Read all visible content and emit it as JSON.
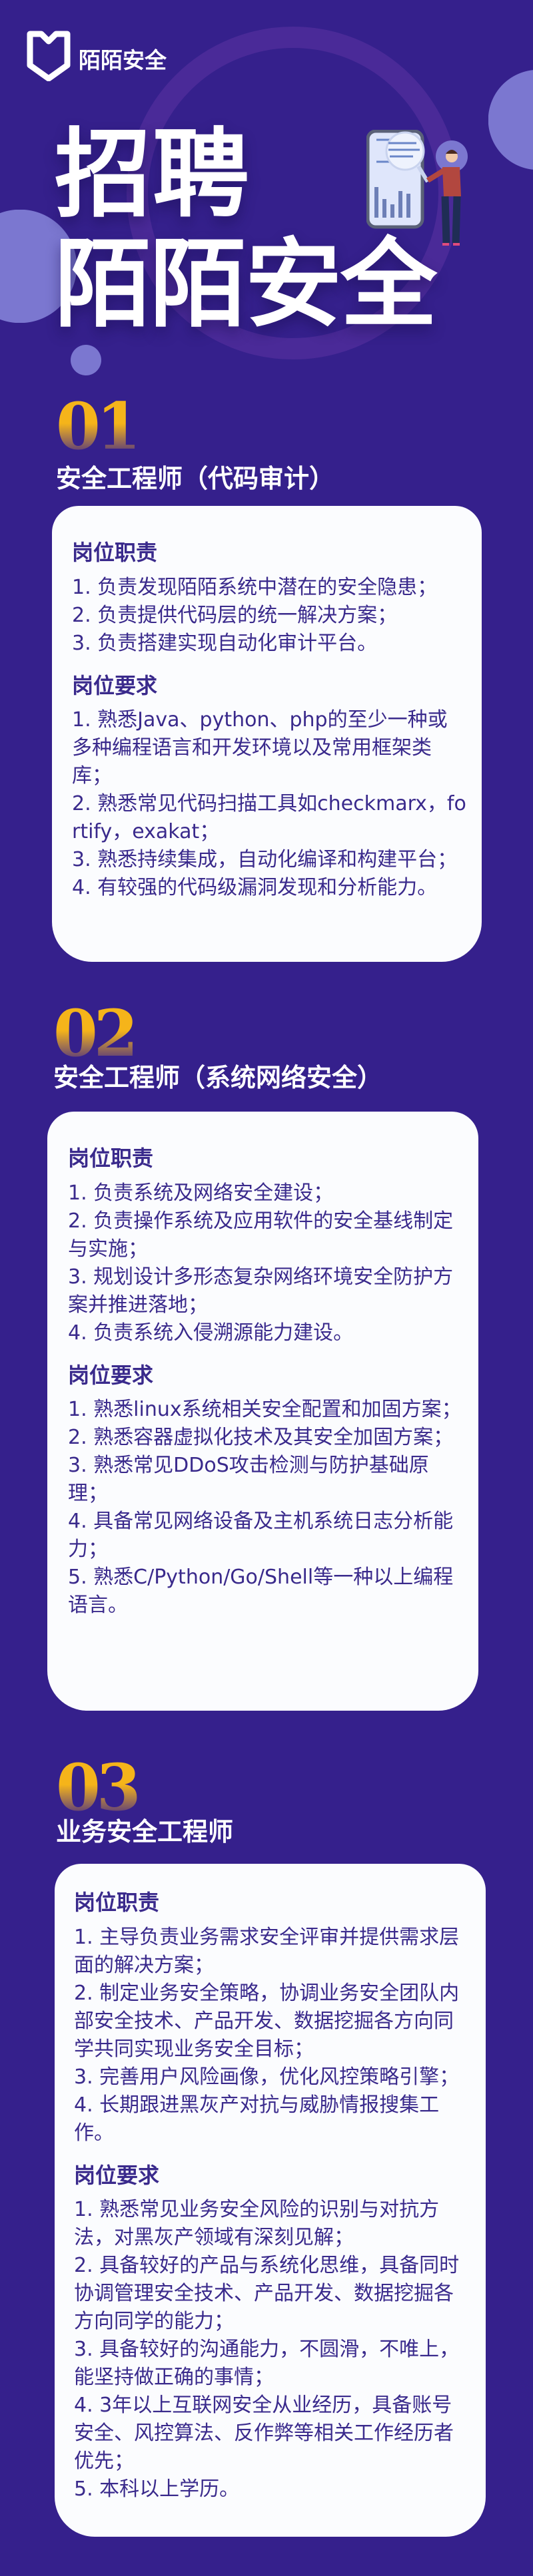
{
  "brand": {
    "name": "陌陌安全",
    "logo_icon": "shield-icon"
  },
  "hero": {
    "line1": "招聘",
    "line2": "陌陌安全",
    "illustration": "person-inspecting-report-icon"
  },
  "colors": {
    "background": "#35208c",
    "accent_gold": "#f5b41a",
    "card_text": "#3a2a8c",
    "circle": "#7b77d0"
  },
  "jobs": [
    {
      "number": "01",
      "title": "安全工程师（代码审计）",
      "duties_label": "岗位职责",
      "duties": [
        "1. 负责发现陌陌系统中潜在的安全隐患；",
        "2. 负责提供代码层的统一解决方案；",
        "3. 负责搭建实现自动化审计平台。"
      ],
      "req_label": "岗位要求",
      "reqs": [
        "1. 熟悉Java、python、php的至少一种或多种编程语言和开发环境以及常用框架类库；",
        "2. 熟悉常见代码扫描工具如checkmarx，fortify，exakat；",
        "3. 熟悉持续集成，自动化编译和构建平台；",
        "4. 有较强的代码级漏洞发现和分析能力。"
      ]
    },
    {
      "number": "02",
      "title": "安全工程师（系统网络安全）",
      "duties_label": "岗位职责",
      "duties": [
        "1. 负责系统及网络安全建设；",
        "2. 负责操作系统及应用软件的安全基线制定与实施；",
        "3. 规划设计多形态复杂网络环境安全防护方案并推进落地；",
        "4. 负责系统入侵溯源能力建设。"
      ],
      "req_label": "岗位要求",
      "reqs": [
        "1. 熟悉linux系统相关安全配置和加固方案；",
        "2. 熟悉容器虚拟化技术及其安全加固方案；",
        "3. 熟悉常见DDoS攻击检测与防护基础原理；",
        "4. 具备常见网络设备及主机系统日志分析能力；",
        "5. 熟悉C/Python/Go/Shell等一种以上编程语言。"
      ]
    },
    {
      "number": "03",
      "title": "业务安全工程师",
      "duties_label": "岗位职责",
      "duties": [
        "1. 主导负责业务需求安全评审并提供需求层面的解决方案；",
        "2. 制定业务安全策略，协调业务安全团队内部安全技术、产品开发、数据挖掘各方向同学共同实现业务安全目标；",
        "3. 完善用户风险画像，优化风控策略引擎；",
        "4. 长期跟进黑灰产对抗与威胁情报搜集工作。"
      ],
      "req_label": "岗位要求",
      "reqs": [
        "1. 熟悉常见业务安全风险的识别与对抗方法，对黑灰产领域有深刻见解；",
        "2. 具备较好的产品与系统化思维，具备同时协调管理安全技术、产品开发、数据挖掘各方向同学的能力；",
        "3. 具备较好的沟通能力，不圆滑，不唯上，能坚持做正确的事情；",
        "4. 3年以上互联网安全从业经历，具备账号安全、风控算法、反作弊等相关工作经历者优先；",
        "5. 本科以上学历。"
      ]
    }
  ]
}
